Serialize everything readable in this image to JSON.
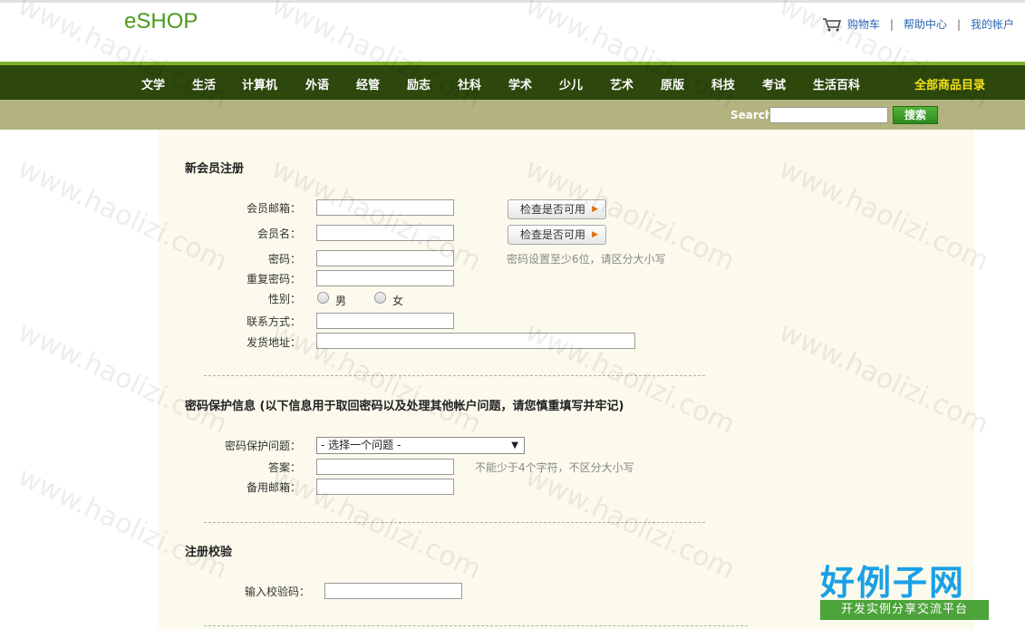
{
  "header": {
    "logo": "eSHOP",
    "cart": "购物车",
    "help": "帮助中心",
    "account": "我的帐户",
    "separator": "|"
  },
  "nav": {
    "items": [
      "文学",
      "生活",
      "计算机",
      "外语",
      "经管",
      "励志",
      "社科",
      "学术",
      "少儿",
      "艺术",
      "原版",
      "科技",
      "考试",
      "生活百科"
    ],
    "all": "全部商品目录"
  },
  "search": {
    "label": "Search",
    "value": "",
    "button": "搜索"
  },
  "register": {
    "title": "新会员注册",
    "email_label": "会员邮箱：",
    "username_label": "会员名：",
    "password_label": "密码：",
    "repeat_password_label": "重复密码：",
    "gender_label": "性别：",
    "male": "男",
    "female": "女",
    "contact_label": "联系方式：",
    "address_label": "发货地址：",
    "check_button": "检查是否可用",
    "password_hint": "密码设置至少6位，请区分大小写"
  },
  "protection": {
    "title": "密码保护信息 (以下信息用于取回密码以及处理其他帐户问题，请您慎重填写并牢记)",
    "question_label": "密码保护问题：",
    "question_selected": "- 选择一个问题 -",
    "answer_label": "答案：",
    "answer_hint": "不能少于4个字符，不区分大小写",
    "backup_email_label": "备用邮箱："
  },
  "verify": {
    "title": "注册校验",
    "code_label": "输入校验码："
  },
  "watermark": {
    "text": "www.haolizi.com",
    "badge_big": "好例子网",
    "badge_small": "开发实例分享交流平台"
  }
}
